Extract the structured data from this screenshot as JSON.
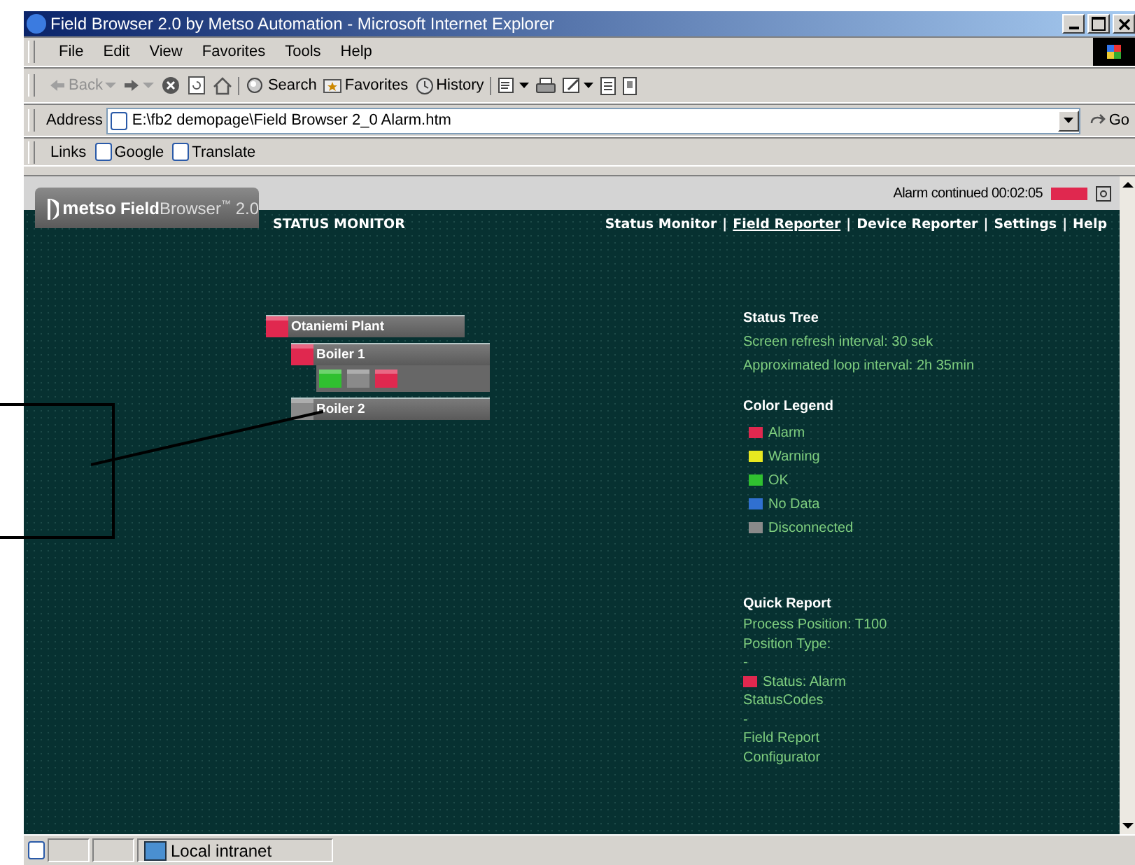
{
  "window": {
    "title": "Field Browser 2.0 by Metso Automation - Microsoft Internet Explorer"
  },
  "menu": {
    "items": [
      {
        "label": "File"
      },
      {
        "label": "Edit"
      },
      {
        "label": "View"
      },
      {
        "label": "Favorites"
      },
      {
        "label": "Tools"
      },
      {
        "label": "Help"
      }
    ]
  },
  "toolbar": {
    "items": [
      {
        "kind": "back",
        "label": "Back",
        "disabled": true
      },
      {
        "kind": "forward",
        "disabled": false
      },
      {
        "kind": "stop"
      },
      {
        "kind": "refresh"
      },
      {
        "kind": "home"
      },
      {
        "kind": "search",
        "label": "Search"
      },
      {
        "kind": "favorites",
        "label": "Favorites"
      },
      {
        "kind": "history",
        "label": "History"
      },
      {
        "kind": "mail"
      },
      {
        "kind": "print"
      },
      {
        "kind": "edit"
      },
      {
        "kind": "discuss"
      },
      {
        "kind": "messenger"
      }
    ]
  },
  "address_bar": {
    "label": "Address",
    "value": "E:\\fb2 demopage\\Field Browser 2_0 Alarm.htm",
    "go": "Go"
  },
  "links_bar": {
    "label": "Links",
    "items": [
      {
        "label": "Google"
      },
      {
        "label": "Translate"
      }
    ]
  },
  "page": {
    "logo": {
      "brand": "metso",
      "product": "**Field**Browser$^{™}$ 2.0"
    },
    "section_title": "STATUS MONITOR",
    "alarm": {
      "text": "Alarm continued 00:02:05",
      "color": "#e0284f"
    },
    "nav": {
      "separator": "|",
      "items": [
        {
          "label": "Status Monitor",
          "underlined": false
        },
        {
          "label": "Field Reporter",
          "underlined": true
        },
        {
          "label": "Device Reporter",
          "underlined": false
        },
        {
          "label": "Settings",
          "underlined": false
        },
        {
          "label": "Help",
          "underlined": false
        }
      ]
    },
    "tree": [
      {
        "name": "Otaniemi Plant",
        "color": "#e0284f",
        "children": [
          {
            "name": "Boiler 1",
            "color": "#e0284f",
            "indicators": [
              {
                "color": "#30c030"
              },
              {
                "color": "#8a8a8a"
              },
              {
                "color": "#e0284f"
              }
            ]
          },
          {
            "name": "Boiler 2",
            "color": "#8a8a8a"
          }
        ]
      }
    ],
    "status_tree": {
      "title": "Status Tree",
      "lines": [
        "Screen refresh interval: 30 sek",
        "Approximated loop interval: 2h 35min"
      ]
    },
    "legend": {
      "title": "Color Legend",
      "items": [
        {
          "label": "Alarm",
          "color": "#e0284f"
        },
        {
          "label": "Warning",
          "color": "#e8e820"
        },
        {
          "label": "OK",
          "color": "#30c030"
        },
        {
          "label": "No Data",
          "color": "#3070d0"
        },
        {
          "label": "Disconnected",
          "color": "#8a8a8a"
        }
      ]
    },
    "quick_report": {
      "title": "Quick Report",
      "lines": [
        {
          "kind": "text",
          "text": "Process Position: T100"
        },
        {
          "kind": "text",
          "text": "Position Type:"
        },
        {
          "kind": "text",
          "text": "-"
        },
        {
          "kind": "status",
          "text": "Status: Alarm",
          "color": "#e0284f"
        },
        {
          "kind": "text",
          "text": "StatusCodes"
        },
        {
          "kind": "text",
          "text": "-"
        },
        {
          "kind": "text",
          "text": "Field Report"
        },
        {
          "kind": "text",
          "text": "Configurator"
        }
      ]
    }
  },
  "status_bar": {
    "zone": "Local intranet"
  }
}
